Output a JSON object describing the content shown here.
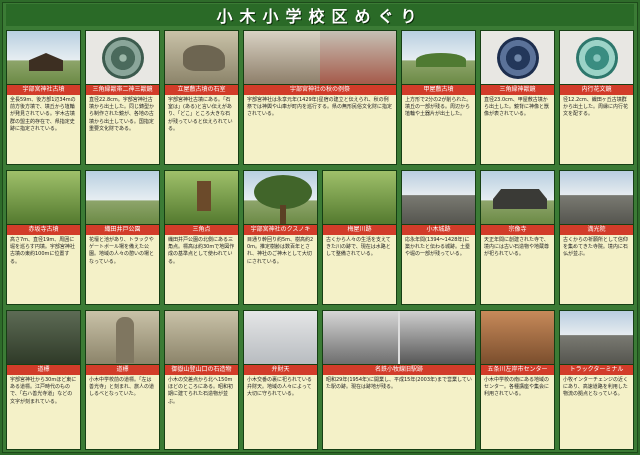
{
  "title": "小木小学校区めぐり",
  "row1": [
    {
      "caption": "宇部宮神社古墳",
      "text": "全長59m、後方部1辺34mの前方後方墳で、墳丘から埴輪が発見されている。宇木古墳群の盟主的存在で、県指定史跡に指定されている。"
    },
    {
      "caption": "三角縁獣帯二神三獣鏡",
      "text": "直径22.8cm。宇部宮神社古墳から出土した。同じ鋳型から制作された鏡が、各地の古墳から出土している。国指定重要文化財である。"
    },
    {
      "caption": "立屋敷古墳の石室",
      "text": "宇部宮神社古墳にある。「石室は」(ある)と言い伝えがあり、「どこ」ところ大きな石が残っていると伝えられている。"
    },
    {
      "caption": "宇部宮神社の秋の例祭",
      "text": "宇部宮神社は永享元年(1429年)星宿の建立と伝えられ、秋の例祭では神輿や山車が町内を巡行する。県の無形民俗文化財に指定されている。"
    },
    {
      "caption": "甲屋敷古墳",
      "text": "上方形で2分の2が削られた。墳丘の一部が残る。周辺から埴輪や土器片が出土した。"
    },
    {
      "caption": "三角縁神獣鏡",
      "text": "直径23.0cm、甲屋敷古墳から出土した。鏡背に神像と獣像が表されている。"
    },
    {
      "caption": "内行花文鏡",
      "text": "径12.2cm、織田ヶ丘古墳群から出土した。周縁に内行花文を配する。"
    }
  ],
  "row2": [
    {
      "caption": "赤坂寺古墳",
      "text": "高さ7m、直径19m、周囲に堀を巡らす円墳。宇部宮神社古墳の東約100mに位置する。"
    },
    {
      "caption": "織田井戸公園",
      "text": "花壇と池があり、トラックやゲートボール場を備えた公園。地域の人々の憩いの場となっている。"
    },
    {
      "caption": "三角点",
      "text": "織田井戸公園の北側にある三角点。標高は約30mで地図作成の基準点として使われている。"
    },
    {
      "caption": "宇部宮神社のクスノキ",
      "text": "目通り幹回り約5m、樹高約20m。推定樹齢は数百年とされ、神社のご神木として大切にされている。"
    },
    {
      "caption": "梅屋川跡",
      "text": "古くから人々の生活を支えてきた川の跡で、現在は水路として整備されている。"
    },
    {
      "caption": "小木城跡",
      "text": "応永年間(1394〜1428年)に築かれたと伝わる城跡。土塁や堀の一部が残っている。"
    },
    {
      "caption": "宗像寺",
      "text": "天正年間に創建された寺で、境内には古い石造物や地蔵尊が祀られている。"
    },
    {
      "caption": "満光院",
      "text": "古くからの祈願所として信仰を集めてきた寺院。境内に石仏が並ぶ。"
    }
  ],
  "row3": [
    {
      "caption": "道標",
      "text": "宇部宮神社から30mほど東にある道標。江戸時代のもので、「右ハ善光寺道」などの文字が刻まれている。"
    },
    {
      "caption": "道標",
      "text": "小木中学校前の道標。「左は善光寺」と刻まれ、旅人の道しるべとなっていた。"
    },
    {
      "caption": "御嶽山登山口の石造物",
      "text": "小木の交差点から北へ150mほどのところにある。昭和初期に建てられた石造物が並ぶ。"
    },
    {
      "caption": "弁財天",
      "text": "小木交番の裏に祀られている弁財天。地域の人々によって大切に守られている。"
    },
    {
      "caption": "名鉄小牧線旧駅跡",
      "text": "昭和29年(1954年)に開業し、平成15年(2003年)まで営業していた駅の跡。現在は跡地が残る。"
    },
    {
      "caption": "名鉄小牧線旧駅",
      "text": "(写真:旧小木駅・昭和29年〜平成15年)"
    },
    {
      "caption": "五条川左岸市センター",
      "text": "小木中学校の南にある地域のセンター。各種講座や集会に利用されている。"
    },
    {
      "caption": "トラックターミナル",
      "text": "小牧インターチェンジの近くにあり、高速道路を利用した物流の拠点となっている。"
    }
  ]
}
